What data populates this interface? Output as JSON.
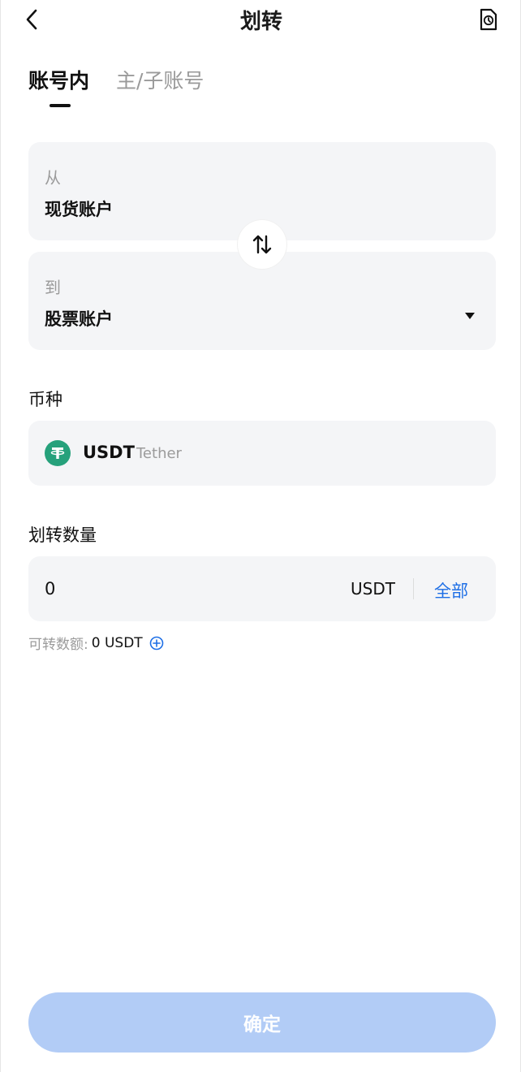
{
  "header": {
    "title": "划转",
    "back_icon": "chevron-left-icon",
    "history_icon": "history-icon"
  },
  "tabs": [
    {
      "label": "账号内",
      "active": true
    },
    {
      "label": "主/子账号",
      "active": false
    }
  ],
  "transfer": {
    "from_label": "从",
    "from_value": "现货账户",
    "to_label": "到",
    "to_value": "股票账户",
    "swap_icon": "swap-vertical-icon"
  },
  "currency": {
    "section_label": "币种",
    "symbol": "USDT",
    "name": "Tether",
    "icon": "tether-icon",
    "icon_color": "#26a17b"
  },
  "amount": {
    "section_label": "划转数量",
    "value": "0",
    "unit": "USDT",
    "all_label": "全部"
  },
  "available": {
    "label": "可转数额:",
    "value": "0 USDT",
    "add_icon": "plus-circle-icon"
  },
  "confirm": {
    "label": "确定"
  },
  "colors": {
    "accent": "#1e6fe6",
    "confirm_disabled": "#b2ccf6",
    "card_bg": "#f4f5f7"
  }
}
